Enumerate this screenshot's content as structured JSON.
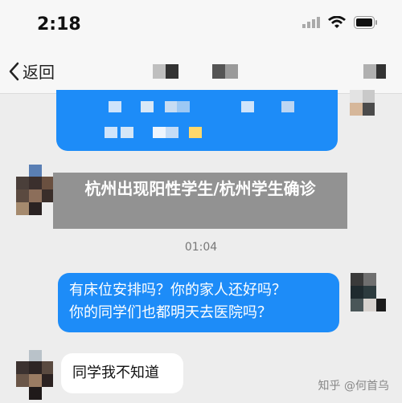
{
  "status_bar": {
    "time": "2:18",
    "icons": [
      "signal-icon",
      "wifi-icon",
      "battery-icon"
    ]
  },
  "nav": {
    "back_label": "返回",
    "back_icon": "chevron-left-icon"
  },
  "overlay": {
    "title": "杭州出现阳性学生/杭州学生确诊"
  },
  "messages": {
    "timestamp": "01:04",
    "outgoing_line1": "有床位安排吗？你的家人还好吗？",
    "outgoing_line2": "你的同学们也都明天去医院吗？",
    "incoming": "同学我不知道"
  },
  "watermark": "知乎 @何首乌",
  "colors": {
    "bubble_blue": "#1d8cf8",
    "background": "#ededed",
    "header": "#f7f7f7"
  }
}
